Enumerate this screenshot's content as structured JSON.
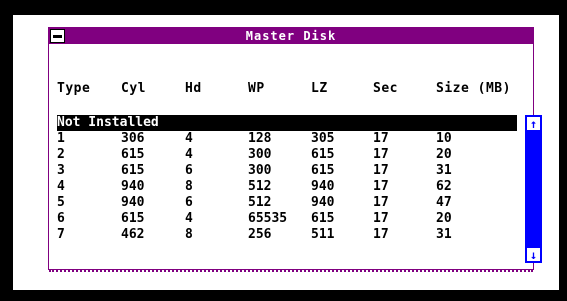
{
  "window": {
    "title": "Master Disk"
  },
  "columns": [
    "Type",
    "Cyl",
    "Hd",
    "WP",
    "LZ",
    "Sec",
    "Size (MB)"
  ],
  "list": {
    "selected_label": "Not Installed",
    "rows": [
      [
        "1",
        "306",
        "4",
        "128",
        "305",
        "17",
        "10"
      ],
      [
        "2",
        "615",
        "4",
        "300",
        "615",
        "17",
        "20"
      ],
      [
        "3",
        "615",
        "6",
        "300",
        "615",
        "17",
        "31"
      ],
      [
        "4",
        "940",
        "8",
        "512",
        "940",
        "17",
        "62"
      ],
      [
        "5",
        "940",
        "6",
        "512",
        "940",
        "17",
        "47"
      ],
      [
        "6",
        "615",
        "4",
        "65535",
        "615",
        "17",
        "20"
      ],
      [
        "7",
        "462",
        "8",
        "256",
        "511",
        "17",
        "31"
      ]
    ]
  },
  "scrollbar": {
    "up_icon": "↑",
    "down_icon": "↓"
  },
  "colors": {
    "titlebar": "#800080",
    "scrollbar": "#0000ff",
    "selection": "#000000"
  }
}
